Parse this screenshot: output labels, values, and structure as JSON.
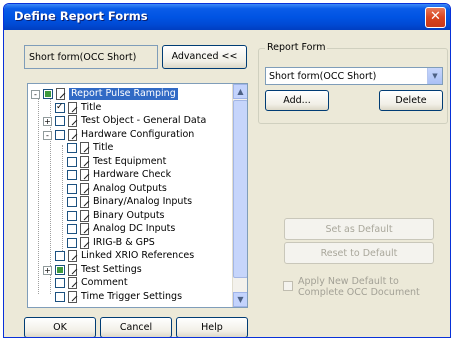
{
  "window": {
    "title": "Define Report Forms",
    "close_label": "✕"
  },
  "top": {
    "form_field_value": "Short form(OCC Short)",
    "advanced_label": "Advanced <<"
  },
  "report_form": {
    "legend": "Report Form",
    "selected": "Short form(OCC Short)",
    "add_label": "Add...",
    "delete_label": "Delete",
    "set_default_label": "Set as Default",
    "reset_default_label": "Reset to Default",
    "apply_label": "Apply New Default to Complete OCC Document"
  },
  "tree": {
    "items": [
      {
        "label": "Report Pulse Ramping",
        "check": "part",
        "exp": "-"
      },
      {
        "label": "Title",
        "check": "on",
        "exp": ""
      },
      {
        "label": "Test Object - General Data",
        "check": "off",
        "exp": "+"
      },
      {
        "label": "Hardware Configuration",
        "check": "off",
        "exp": "-"
      },
      {
        "label": "Title",
        "check": "off",
        "exp": ""
      },
      {
        "label": "Test Equipment",
        "check": "off",
        "exp": ""
      },
      {
        "label": "Hardware Check",
        "check": "off",
        "exp": ""
      },
      {
        "label": "Analog Outputs",
        "check": "off",
        "exp": ""
      },
      {
        "label": "Binary/Analog Inputs",
        "check": "off",
        "exp": ""
      },
      {
        "label": "Binary Outputs",
        "check": "off",
        "exp": ""
      },
      {
        "label": "Analog DC Inputs",
        "check": "off",
        "exp": ""
      },
      {
        "label": "IRIG-B & GPS",
        "check": "off",
        "exp": ""
      },
      {
        "label": "Linked XRIO References",
        "check": "off",
        "exp": ""
      },
      {
        "label": "Test Settings",
        "check": "part",
        "exp": "+"
      },
      {
        "label": "Comment",
        "check": "off",
        "exp": ""
      },
      {
        "label": "Time Trigger Settings",
        "check": "off",
        "exp": ""
      }
    ]
  },
  "bottom": {
    "ok_label": "OK",
    "cancel_label": "Cancel",
    "help_label": "Help"
  }
}
